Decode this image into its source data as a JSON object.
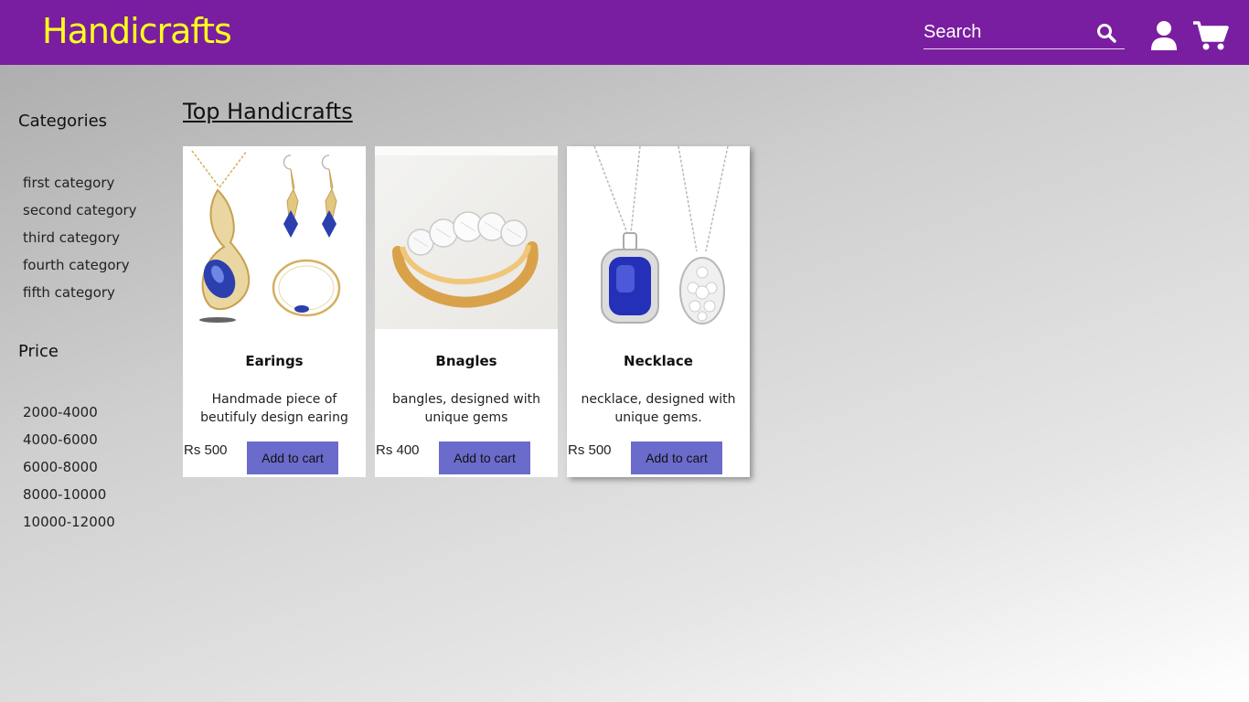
{
  "header": {
    "brand": "Handicrafts",
    "search_placeholder": "Search",
    "brand_color": "#ffff1a",
    "bar_color": "#7a1ea1"
  },
  "sidebar": {
    "categories_heading": "Categories",
    "categories": [
      "first category",
      "second category",
      "third category",
      "fourth category",
      "fifth category"
    ],
    "price_heading": "Price",
    "prices": [
      "2000-4000",
      "4000-6000",
      "6000-8000",
      "8000-10000",
      "10000-12000"
    ]
  },
  "main": {
    "title": "Top Handicrafts",
    "products": [
      {
        "name": "Earings",
        "description": "Handmade piece of beutifuly design earing",
        "price": "Rs 500",
        "button": "Add to cart",
        "image_icon": "earrings-jewelry-image"
      },
      {
        "name": "Bnagles",
        "description": "bangles, designed with unique gems",
        "price": "Rs 400",
        "button": "Add to cart",
        "image_icon": "ring-jewelry-image"
      },
      {
        "name": "Necklace",
        "description": "necklace, designed with unique gems.",
        "price": "Rs 500",
        "button": "Add to cart",
        "image_icon": "necklace-jewelry-image"
      }
    ],
    "button_color": "#6b6bcc"
  }
}
